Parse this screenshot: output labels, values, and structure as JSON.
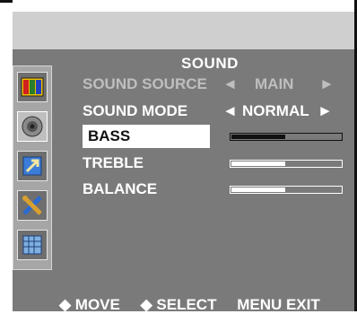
{
  "menu": {
    "title": "SOUND",
    "rows": [
      {
        "label": "SOUND SOURCE",
        "value": "MAIN",
        "left_arrow": "◄",
        "right_arrow": "►"
      },
      {
        "label": "SOUND MODE",
        "value": "NORMAL",
        "left_arrow": "◄",
        "right_arrow": "►"
      },
      {
        "label": "BASS",
        "level": 0.5
      },
      {
        "label": "TREBLE",
        "level": 0.5
      },
      {
        "label": "BALANCE",
        "level": 0.5
      }
    ]
  },
  "footer": {
    "move": "◆ MOVE",
    "select": "◆ SELECT",
    "exit": "MENU EXIT"
  },
  "icons": [
    "picture-icon",
    "speaker-icon",
    "screen-adjust-icon",
    "tools-icon",
    "grid-icon"
  ],
  "colors": {
    "osd_background": "#7a7a7a",
    "top_band": "#cfcfcf",
    "selected_row": "#ffffff"
  }
}
